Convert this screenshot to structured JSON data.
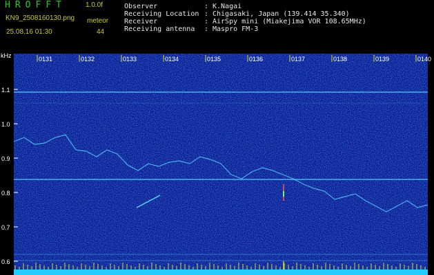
{
  "header": {
    "app_title": "HROFFT",
    "app_version": "1.0.0f",
    "file_name": "KN9_2508160130.png",
    "mode_label": "meteor",
    "date_time": "25.08.16 01:30",
    "mode_value": "44"
  },
  "station": [
    {
      "key": "Observer",
      "value": "K.Nagai"
    },
    {
      "key": "Receiving Location",
      "value": "Chigasaki, Japan (139.414 35.340)"
    },
    {
      "key": "Receiver",
      "value": "AirSpy mini (Miakejima VOR 108.65MHz)"
    },
    {
      "key": "Receiving antenna",
      "value": "Maspro FM-3"
    }
  ],
  "info_separator": ":",
  "y_axis": {
    "unit": "kHz",
    "ticks": [
      "1.1",
      "1.0",
      "0.9",
      "0.8",
      "0.7",
      "0.6"
    ]
  },
  "x_axis": {
    "ticks": [
      "0131",
      "0132",
      "0133",
      "0134",
      "0135",
      "0136",
      "0137",
      "0138",
      "0139",
      "0140"
    ]
  },
  "colors": {
    "background": "#000000",
    "spectrogram_base": "#0a1a8c",
    "signal_line": "#5fd8ff",
    "title_green": "#22cc22",
    "label_yellow": "#cccc33",
    "bottom_bar": "#22ccff",
    "tick_yellow": "#dddd22"
  }
}
